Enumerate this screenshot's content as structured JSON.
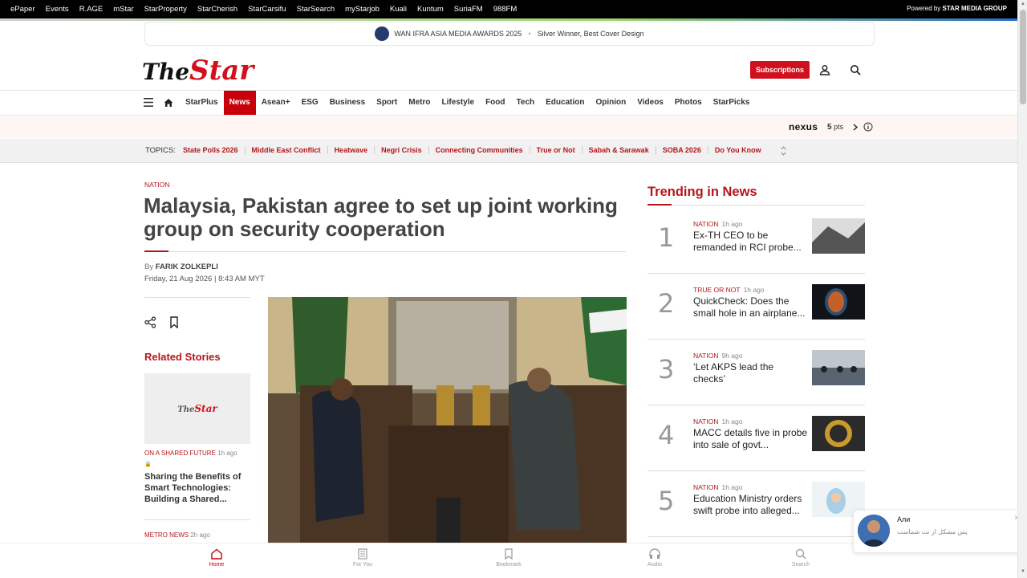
{
  "topbar": {
    "links": [
      "ePaper",
      "Events",
      "R.AGE",
      "mStar",
      "StarProperty",
      "StarCherish",
      "StarCarsifu",
      "StarSearch",
      "myStarjob",
      "Kuali",
      "Kuntum",
      "SuriaFM",
      "988FM"
    ],
    "powered_prefix": "Powered by",
    "powered_brand": "STAR MEDIA GROUP"
  },
  "award": {
    "title": "WAN IFRA ASIA MEDIA AWARDS 2025",
    "detail": "Silver Winner, Best Cover Design"
  },
  "logo": {
    "the": "The",
    "star": "Star"
  },
  "header": {
    "subscribe_label": "Subscriptions"
  },
  "nav": {
    "items": [
      "StarPlus",
      "News",
      "Asean+",
      "ESG",
      "Business",
      "Sport",
      "Metro",
      "Lifestyle",
      "Food",
      "Tech",
      "Education",
      "Opinion",
      "Videos",
      "Photos",
      "StarPicks"
    ],
    "active": "News"
  },
  "nexus": {
    "brand": "nexus",
    "points": "5",
    "points_unit": "pts"
  },
  "topics": {
    "label": "TOPICS:",
    "items": [
      "State Polls 2026",
      "Middle East Conflict",
      "Heatwave",
      "Negri Crisis",
      "Connecting Communities",
      "True or Not",
      "Sabah & Sarawak",
      "SOBA 2026",
      "Do You Know"
    ]
  },
  "article": {
    "kicker": "NATION",
    "headline": "Malaysia, Pakistan agree to set up joint working group on security cooperation",
    "by_prefix": "By",
    "author": "FARIK ZOLKEPLI",
    "date": "Friday, 21 Aug 2026 | 8:43 AM MYT"
  },
  "related": {
    "title": "Related Stories",
    "items": [
      {
        "category": "ON A SHARED FUTURE",
        "time": "1h ago",
        "title": "Sharing the Benefits of Smart Technologies: Building a Shared..."
      },
      {
        "category": "METRO NEWS",
        "time": "2h ago"
      }
    ]
  },
  "trending": {
    "title": "Trending in News",
    "items": [
      {
        "rank": "1",
        "category": "NATION",
        "time": "1h ago",
        "title": "Ex-TH CEO to be remanded in RCI probe..."
      },
      {
        "rank": "2",
        "category": "TRUE OR NOT",
        "time": "1h ago",
        "title": "QuickCheck: Does the small hole in an airplane..."
      },
      {
        "rank": "3",
        "category": "NATION",
        "time": "9h ago",
        "title": "‘Let AKPS lead the checks’"
      },
      {
        "rank": "4",
        "category": "NATION",
        "time": "1h ago",
        "title": "MACC details five in probe into sale of govt..."
      },
      {
        "rank": "5",
        "category": "NATION",
        "time": "1h ago",
        "title": "Education Ministry orders swift probe into alleged..."
      }
    ]
  },
  "bottom_nav": {
    "items": [
      "Home",
      "For You",
      "Bookmark",
      "Audio",
      "Search"
    ],
    "active": "Home"
  },
  "chat": {
    "name": "Али",
    "message": "پس مشکل از نت شماست"
  },
  "colors": {
    "brand_red": "#c8000b",
    "topic_red": "#b4161b"
  }
}
